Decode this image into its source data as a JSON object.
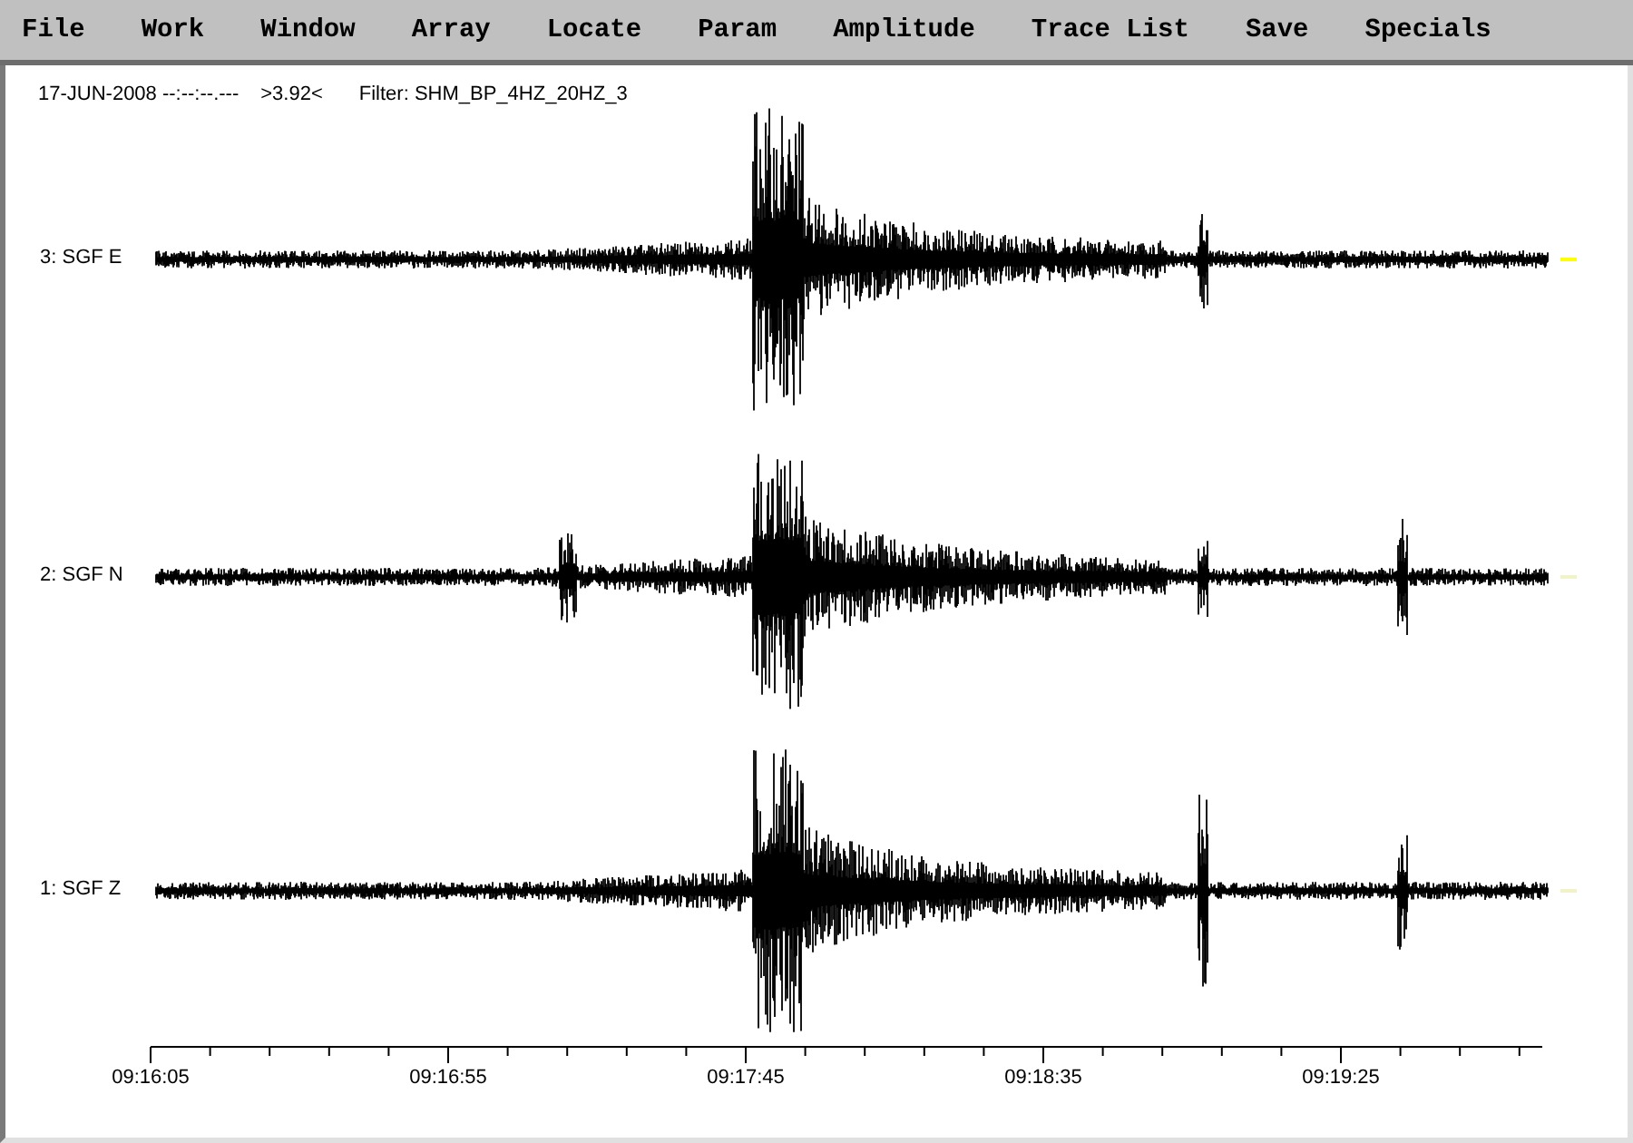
{
  "menu": [
    {
      "label": "File"
    },
    {
      "label": "Work"
    },
    {
      "label": "Window"
    },
    {
      "label": "Array"
    },
    {
      "label": "Locate"
    },
    {
      "label": "Param"
    },
    {
      "label": "Amplitude"
    },
    {
      "label": "Trace List"
    },
    {
      "label": "Save"
    },
    {
      "label": "Specials"
    }
  ],
  "header": {
    "date": "17-JUN-2008 --:--:--.---",
    "value": ">3.92<",
    "filter": "Filter: SHM_BP_4HZ_20HZ_3"
  },
  "traces": [
    {
      "label": "3: SGF E",
      "selected": true
    },
    {
      "label": "2: SGF N",
      "selected": false
    },
    {
      "label": "1: SGF Z",
      "selected": false
    }
  ],
  "time_axis": {
    "labels": [
      "09:16:05",
      "09:16:55",
      "09:17:45",
      "09:18:35",
      "09:19:25"
    ]
  }
}
